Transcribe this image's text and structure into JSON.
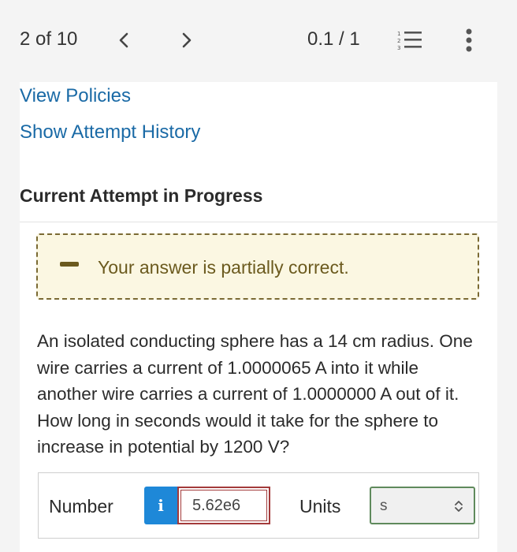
{
  "header": {
    "counter": "2 of 10",
    "score": "0.1 / 1",
    "icons": [
      "chevron-left-icon",
      "chevron-right-icon",
      "numbered-list-icon",
      "more-vertical-icon"
    ]
  },
  "links": {
    "policies": "View Policies",
    "history": "Show Attempt History"
  },
  "section_title": "Current Attempt in Progress",
  "feedback": {
    "message": "Your answer is partially correct.",
    "icon": "minus-icon"
  },
  "question": {
    "text": "An isolated conducting sphere has a 14 cm radius. One wire carries a current of 1.0000065 A into it while another wire carries a current of 1.0000000 A out of it. How long in seconds would it take for the sphere to increase in potential by 1200 V?"
  },
  "answer": {
    "number_label": "Number",
    "info_glyph": "i",
    "value": "5.62e6",
    "units_label": "Units",
    "unit_selected": "s"
  },
  "colors": {
    "link": "#1a6aa6",
    "feedback_bg": "#fbf7e2",
    "feedback_text": "#6b5a1e",
    "info_button": "#1e88d8",
    "incorrect_border": "#a33a3a",
    "correct_border": "#5f8a5c"
  }
}
